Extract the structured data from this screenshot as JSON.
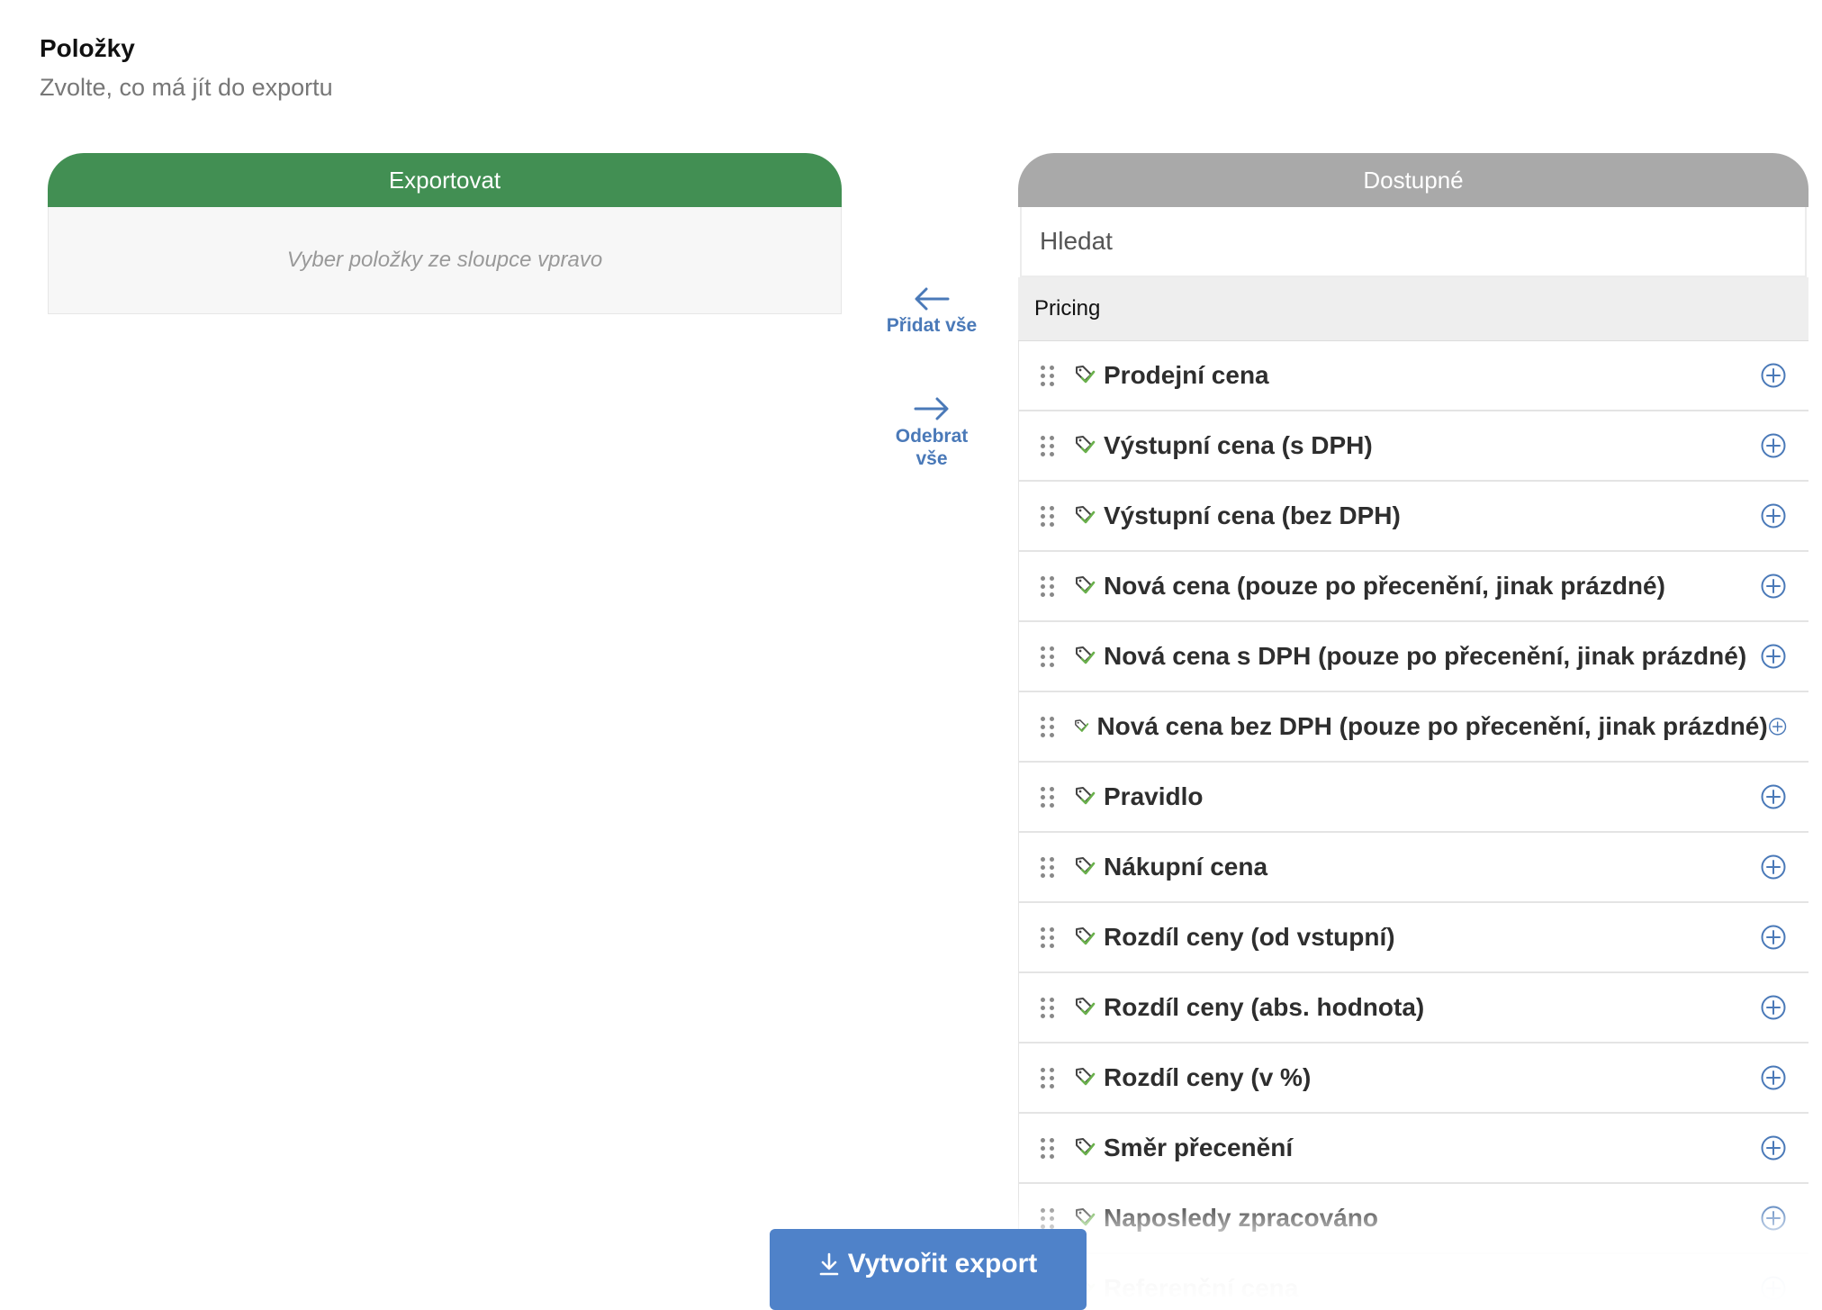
{
  "section": {
    "title": "Položky",
    "subtitle": "Zvolte, co má jít do exportu"
  },
  "export_panel": {
    "header": "Exportovat",
    "empty_text": "Vyber položky ze sloupce vpravo"
  },
  "actions": {
    "add_all": "Přidat vše",
    "remove_all_line1": "Odebrat",
    "remove_all_line2": "vše"
  },
  "available_panel": {
    "header": "Dostupné",
    "search_placeholder": "Hledat",
    "group": "Pricing",
    "items": [
      {
        "label": "Prodejní cena"
      },
      {
        "label": "Výstupní cena (s DPH)"
      },
      {
        "label": "Výstupní cena (bez DPH)"
      },
      {
        "label": "Nová cena (pouze po přecenění, jinak prázdné)"
      },
      {
        "label": "Nová cena s DPH (pouze po přecenění, jinak prázdné)"
      },
      {
        "label": "Nová cena bez DPH (pouze po přecenění, jinak prázdné)"
      },
      {
        "label": "Pravidlo"
      },
      {
        "label": "Nákupní cena"
      },
      {
        "label": "Rozdíl ceny (od vstupní)"
      },
      {
        "label": "Rozdíl ceny (abs. hodnota)"
      },
      {
        "label": "Rozdíl ceny (v %)"
      },
      {
        "label": "Směr přecenění"
      },
      {
        "label": "Naposledy zpracováno"
      },
      {
        "label": "Referenční cena"
      }
    ]
  },
  "footer": {
    "export_button": "Vytvořit export"
  },
  "colors": {
    "export_header": "#428f53",
    "available_header": "#a9a9a9",
    "accent_blue": "#4a79b8",
    "button_blue": "#4f82c9"
  }
}
